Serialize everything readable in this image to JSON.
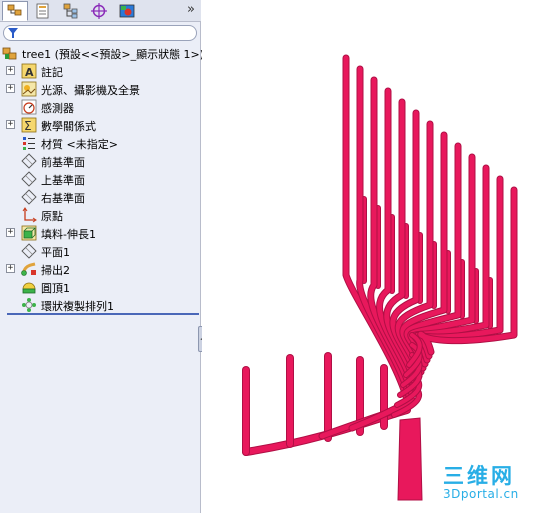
{
  "colors": {
    "model": "#e8185c",
    "model_dark": "#b00f45",
    "panel_bg": "#ebeef7",
    "rollback_bar": "#4a67b8",
    "watermark": "#28aee6"
  },
  "tabs": [
    {
      "name": "feature-manager-tab",
      "icon": "feature-tree-icon",
      "active": true
    },
    {
      "name": "property-manager-tab",
      "icon": "property-sheet-icon",
      "active": false
    },
    {
      "name": "configuration-manager-tab",
      "icon": "configuration-icon",
      "active": false
    },
    {
      "name": "dimxpert-tab",
      "icon": "target-crosshair-icon",
      "active": false
    },
    {
      "name": "display-manager-tab",
      "icon": "appearance-icon",
      "active": false
    }
  ],
  "tab_overflow": "»",
  "tree": {
    "root": "tree1 (預設<<預設>_顯示狀態 1>)",
    "items": [
      {
        "label": "註記",
        "icon": "annotation-icon",
        "expandable": true
      },
      {
        "label": "光源、攝影機及全景",
        "icon": "lights-cameras-icon",
        "expandable": true
      },
      {
        "label": "感測器",
        "icon": "sensor-icon",
        "expandable": false
      },
      {
        "label": "數學關係式",
        "icon": "equations-icon",
        "expandable": true
      },
      {
        "label": "材質 <未指定>",
        "icon": "material-icon",
        "expandable": false
      },
      {
        "label": "前基準面",
        "icon": "plane-icon",
        "expandable": false
      },
      {
        "label": "上基準面",
        "icon": "plane-icon",
        "expandable": false
      },
      {
        "label": "右基準面",
        "icon": "plane-icon",
        "expandable": false
      },
      {
        "label": "原點",
        "icon": "origin-icon",
        "expandable": false
      },
      {
        "label": "填料-伸長1",
        "icon": "extrude-icon",
        "expandable": true
      },
      {
        "label": "平面1",
        "icon": "plane-icon",
        "expandable": false
      },
      {
        "label": "掃出2",
        "icon": "sweep-icon",
        "expandable": true
      },
      {
        "label": "圓頂1",
        "icon": "dome-icon",
        "expandable": false
      },
      {
        "label": "環狀複製排列1",
        "icon": "circular-pattern-icon",
        "expandable": false
      }
    ]
  },
  "watermark": {
    "main": "三维网",
    "sub": "3Dportal.cn"
  }
}
